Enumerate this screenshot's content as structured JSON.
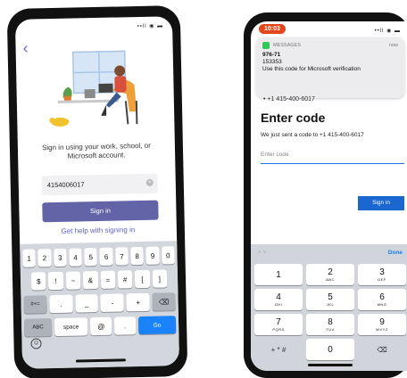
{
  "left": {
    "status_icons": "••ll ◉ ▬",
    "back_icon": "chevron-left-icon",
    "signin_text": "Sign in using your work, school, or Microsoft account.",
    "phone_value": "4154006017",
    "clear_icon": "×",
    "signin_label": "Sign in",
    "help_link": "Get help with signing in",
    "keyboard": {
      "row1": [
        "1",
        "2",
        "3",
        "4",
        "5",
        "6",
        "7",
        "8",
        "9",
        "0"
      ],
      "row2": [
        "$",
        "!",
        "~",
        "&",
        "=",
        "#",
        "[",
        "]"
      ],
      "row3": [
        "#+=",
        ".",
        "_",
        "-",
        "+",
        "⌫"
      ],
      "row4": [
        "ABC",
        "space",
        "@",
        ".",
        "Go"
      ],
      "emoji_icon": "☺"
    },
    "accent_color": "#6264a7"
  },
  "right": {
    "time": "10:03",
    "status_icons": "••ll ◉ ▬",
    "notification": {
      "app": "MESSAGES",
      "time": "now",
      "code": "976-71",
      "sender": "153353",
      "body": "Use this code for Microsoft verification"
    },
    "phone_partial": "• +1 415-400-6017",
    "title": "Enter code",
    "sent_text": "We just sent a code to +1 415-400-6017",
    "code_placeholder": "Enter code",
    "signin_label": "Sign in",
    "keyboard": {
      "done_label": "Done",
      "arrows": "˄  ˅",
      "keys": [
        {
          "digit": "1",
          "letters": ""
        },
        {
          "digit": "2",
          "letters": "ABC"
        },
        {
          "digit": "3",
          "letters": "DEF"
        },
        {
          "digit": "4",
          "letters": "GHI"
        },
        {
          "digit": "5",
          "letters": "JKL"
        },
        {
          "digit": "6",
          "letters": "MNO"
        },
        {
          "digit": "7",
          "letters": "PQRS"
        },
        {
          "digit": "8",
          "letters": "TUV"
        },
        {
          "digit": "9",
          "letters": "WXYZ"
        }
      ],
      "symbols": "+ * #",
      "zero": "0",
      "delete_icon": "⌫"
    },
    "accent_color": "#1a67d2"
  }
}
